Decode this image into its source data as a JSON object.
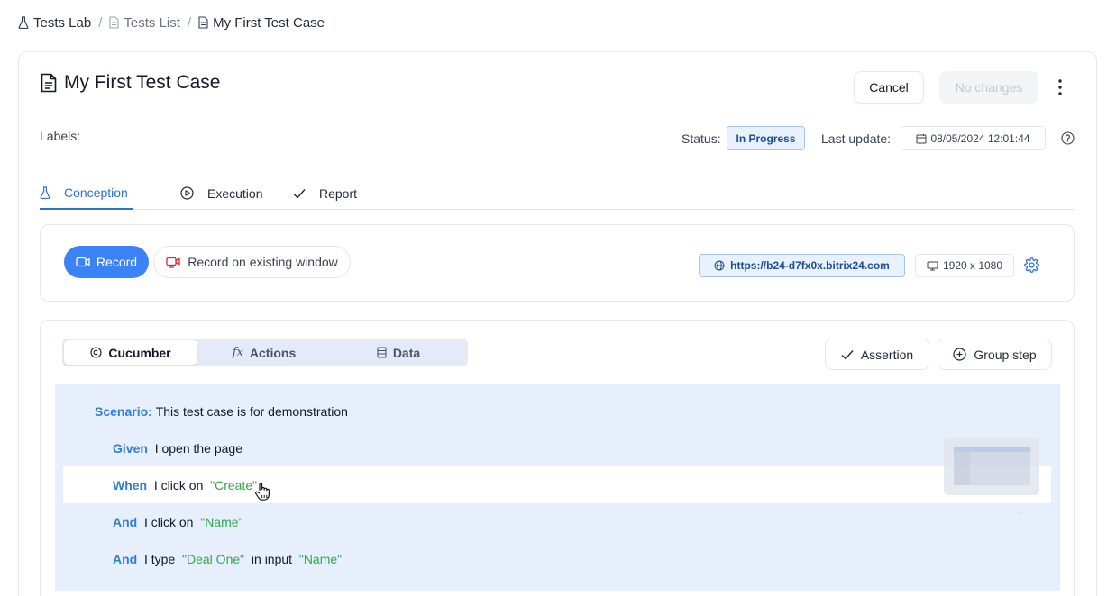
{
  "breadcrumb": {
    "lab": "Tests Lab",
    "list": "Tests List",
    "current": "My First Test Case"
  },
  "header": {
    "title": "My First Test Case",
    "cancel_label": "Cancel",
    "save_label": "No changes"
  },
  "meta": {
    "labels_label": "Labels:",
    "status_label": "Status:",
    "status_value": "In Progress",
    "last_update_label": "Last update:",
    "last_update_value": "08/05/2024 12:01:44"
  },
  "tabs": [
    {
      "label": "Conception",
      "icon": "flask-icon",
      "active": true
    },
    {
      "label": "Execution",
      "icon": "play-circle-icon",
      "active": false
    },
    {
      "label": "Report",
      "icon": "check-icon",
      "active": false
    }
  ],
  "recorder": {
    "record_label": "Record",
    "record_existing_label": "Record on existing window",
    "url": "https://b24-d7fx0x.bitrix24.com",
    "resolution": "1920 x 1080"
  },
  "steps_view": {
    "modes": [
      {
        "label": "Cucumber",
        "icon": "cucumber-icon",
        "active": true
      },
      {
        "label": "Actions",
        "icon": "fx-icon",
        "active": false
      },
      {
        "label": "Data",
        "icon": "table-icon",
        "active": false
      }
    ],
    "assertion_label": "Assertion",
    "group_step_label": "Group step"
  },
  "scenario": {
    "keyword": "Scenario:",
    "text": "This test case is for demonstration",
    "steps": [
      {
        "keyword": "Given",
        "parts": [
          "I open the page"
        ]
      },
      {
        "keyword": "When",
        "parts": [
          "I click on",
          "\"Create\""
        ]
      },
      {
        "keyword": "And",
        "parts": [
          "I click on",
          "\"Name\""
        ]
      },
      {
        "keyword": "And",
        "parts": [
          "I type",
          "\"Deal One\"",
          "in input",
          "\"Name\""
        ]
      }
    ]
  },
  "colors": {
    "accent": "#3b82f6",
    "keyword": "#2f7fd0",
    "string": "#2ea84a",
    "editor_bg": "#e6effb",
    "badge_bg": "#e8f1fd"
  }
}
